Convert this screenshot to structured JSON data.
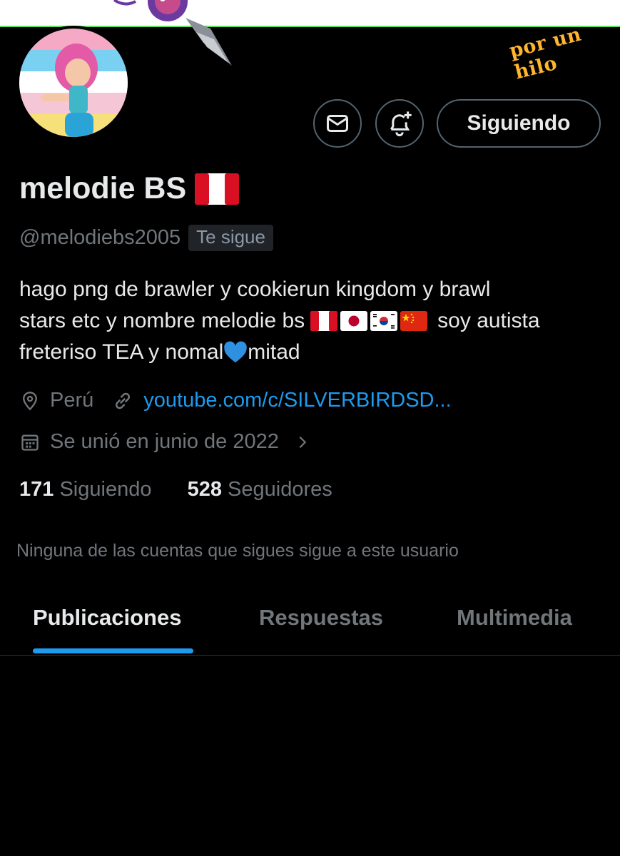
{
  "banner": {
    "watermark": "por un hilo"
  },
  "profile": {
    "display_name": "melodie BS",
    "name_flag": "peru-flag",
    "handle": "@melodiebs2005",
    "follows_you_badge": "Te sigue",
    "bio": {
      "line1": "hago png de brawler y cookierun kingdom y brawl",
      "line2_start": "stars etc y nombre melodie bs",
      "line2_flags": [
        "peru-flag",
        "japan-flag",
        "south-korea-flag",
        "china-flag"
      ],
      "line2_end": "soy autista",
      "line3_start": "freteriso TEA y nomal",
      "line3_emoji": "blue-heart",
      "line3_end": "mitad"
    },
    "location": "Perú",
    "website": "youtube.com/c/SILVERBIRDSD...",
    "joined": "Se unió en junio de 2022",
    "following_count": "171",
    "following_label": "Siguiendo",
    "followers_count": "528",
    "followers_label": "Seguidores",
    "mutuals_notice": "Ninguna de las cuentas que sigues sigue a este usuario"
  },
  "actions": {
    "message_icon": "envelope-icon",
    "notify_icon": "bell-plus-icon",
    "follow_label": "Siguiendo"
  },
  "tabs": [
    {
      "label": "Publicaciones",
      "active": true
    },
    {
      "label": "Respuestas",
      "active": false
    },
    {
      "label": "Multimedia",
      "active": false
    }
  ],
  "colors": {
    "background": "#000000",
    "text_primary": "#e7e9ea",
    "text_secondary": "#71767b",
    "accent": "#1d9bf0",
    "border": "#536471"
  }
}
